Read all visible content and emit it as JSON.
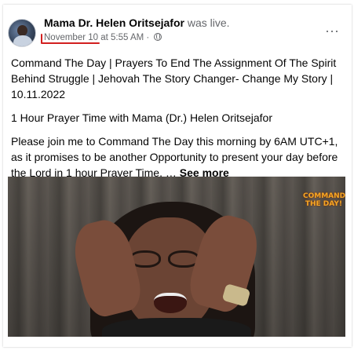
{
  "post": {
    "author": "Mama Dr. Helen Oritsejafor",
    "action": "was live.",
    "date": "November 10",
    "time_suffix": " at 5:55 AM ·",
    "more_label": "···",
    "title": "Command The Day | Prayers To End The Assignment Of The Spirit Behind Struggle | Jehovah The Story Changer- Change My Story | 10.11.2022",
    "subtitle": "1 Hour Prayer Time with Mama (Dr.) Helen Oritsejafor",
    "body": "Please join me to Command The Day this morning by 6AM UTC+1, as it promises to be another Opportunity to present your day before the Lord in 1 hour Prayer Time. … ",
    "see_more": "See more"
  },
  "video": {
    "badge_line1": "COMMAND",
    "badge_line2": "THE DAY!"
  },
  "colors": {
    "link": "#65676b",
    "underline": "#d21f1f",
    "badge": "#f6a623"
  },
  "icons": [
    "avatar",
    "globe-icon",
    "more-icon"
  ]
}
